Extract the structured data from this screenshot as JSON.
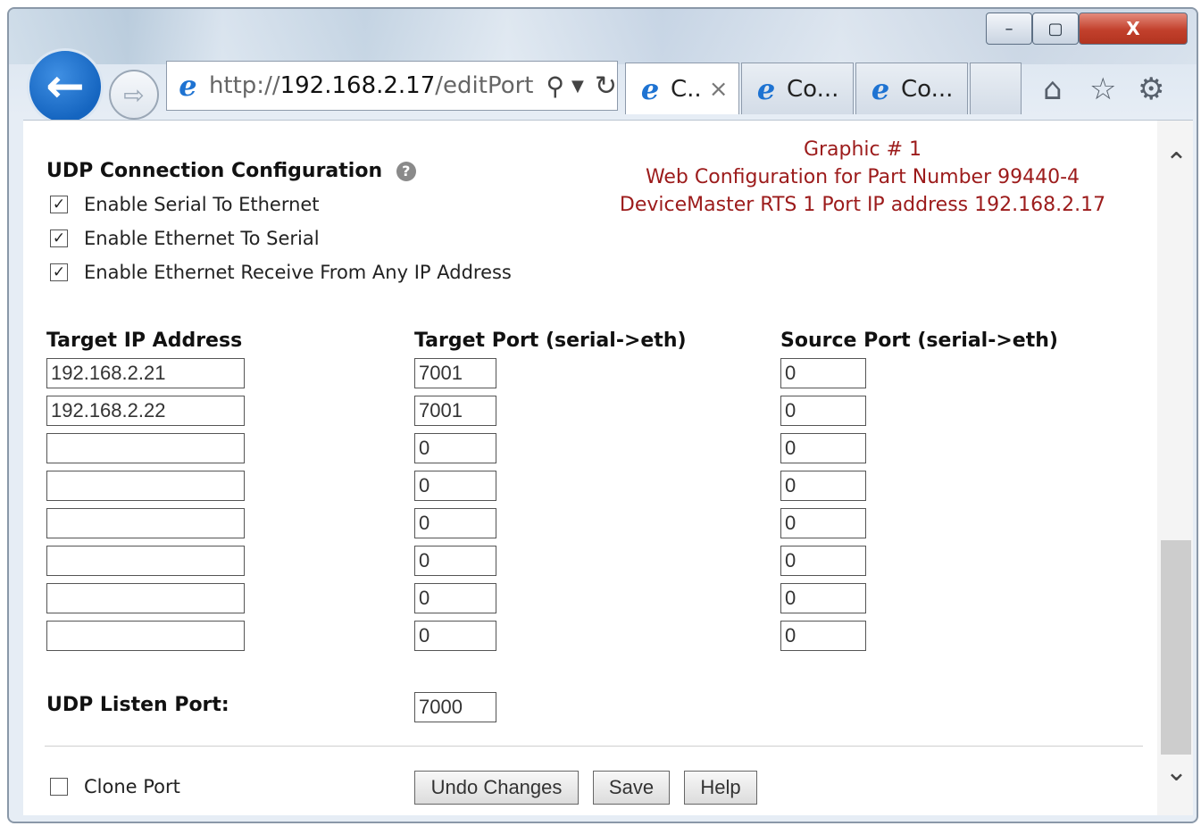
{
  "browser": {
    "url_prefix": "http://",
    "url_host": "192.168.2.17",
    "url_path": "/editPort",
    "tabs": [
      {
        "label": "C..",
        "close": "×"
      },
      {
        "label": "Co..."
      },
      {
        "label": "Co..."
      }
    ],
    "window_controls": {
      "minimize": "–",
      "maximize": "▢",
      "close": "X"
    }
  },
  "note": {
    "line1": "Graphic # 1",
    "line2": "Web Configuration for Part Number 99440-4",
    "line3": "DeviceMaster RTS 1 Port IP address 192.168.2.17"
  },
  "udp_section": {
    "title": "UDP Connection Configuration",
    "options": [
      {
        "label": "Enable Serial To Ethernet",
        "checked": true
      },
      {
        "label": "Enable Ethernet To Serial",
        "checked": true
      },
      {
        "label": "Enable Ethernet Receive From Any IP Address",
        "checked": true
      }
    ]
  },
  "table": {
    "headers": [
      "Target IP Address",
      "Target Port (serial->eth)",
      "Source Port (serial->eth)"
    ],
    "rows": [
      [
        "192.168.2.21",
        "7001",
        "0"
      ],
      [
        "192.168.2.22",
        "7001",
        "0"
      ],
      [
        "",
        "0",
        "0"
      ],
      [
        "",
        "0",
        "0"
      ],
      [
        "",
        "0",
        "0"
      ],
      [
        "",
        "0",
        "0"
      ],
      [
        "",
        "0",
        "0"
      ],
      [
        "",
        "0",
        "0"
      ]
    ]
  },
  "listen": {
    "label": "UDP Listen Port:",
    "value": "7000"
  },
  "clone": {
    "label": "Clone Port",
    "checked": false
  },
  "buttons": {
    "undo": "Undo Changes",
    "save": "Save",
    "help": "Help"
  }
}
